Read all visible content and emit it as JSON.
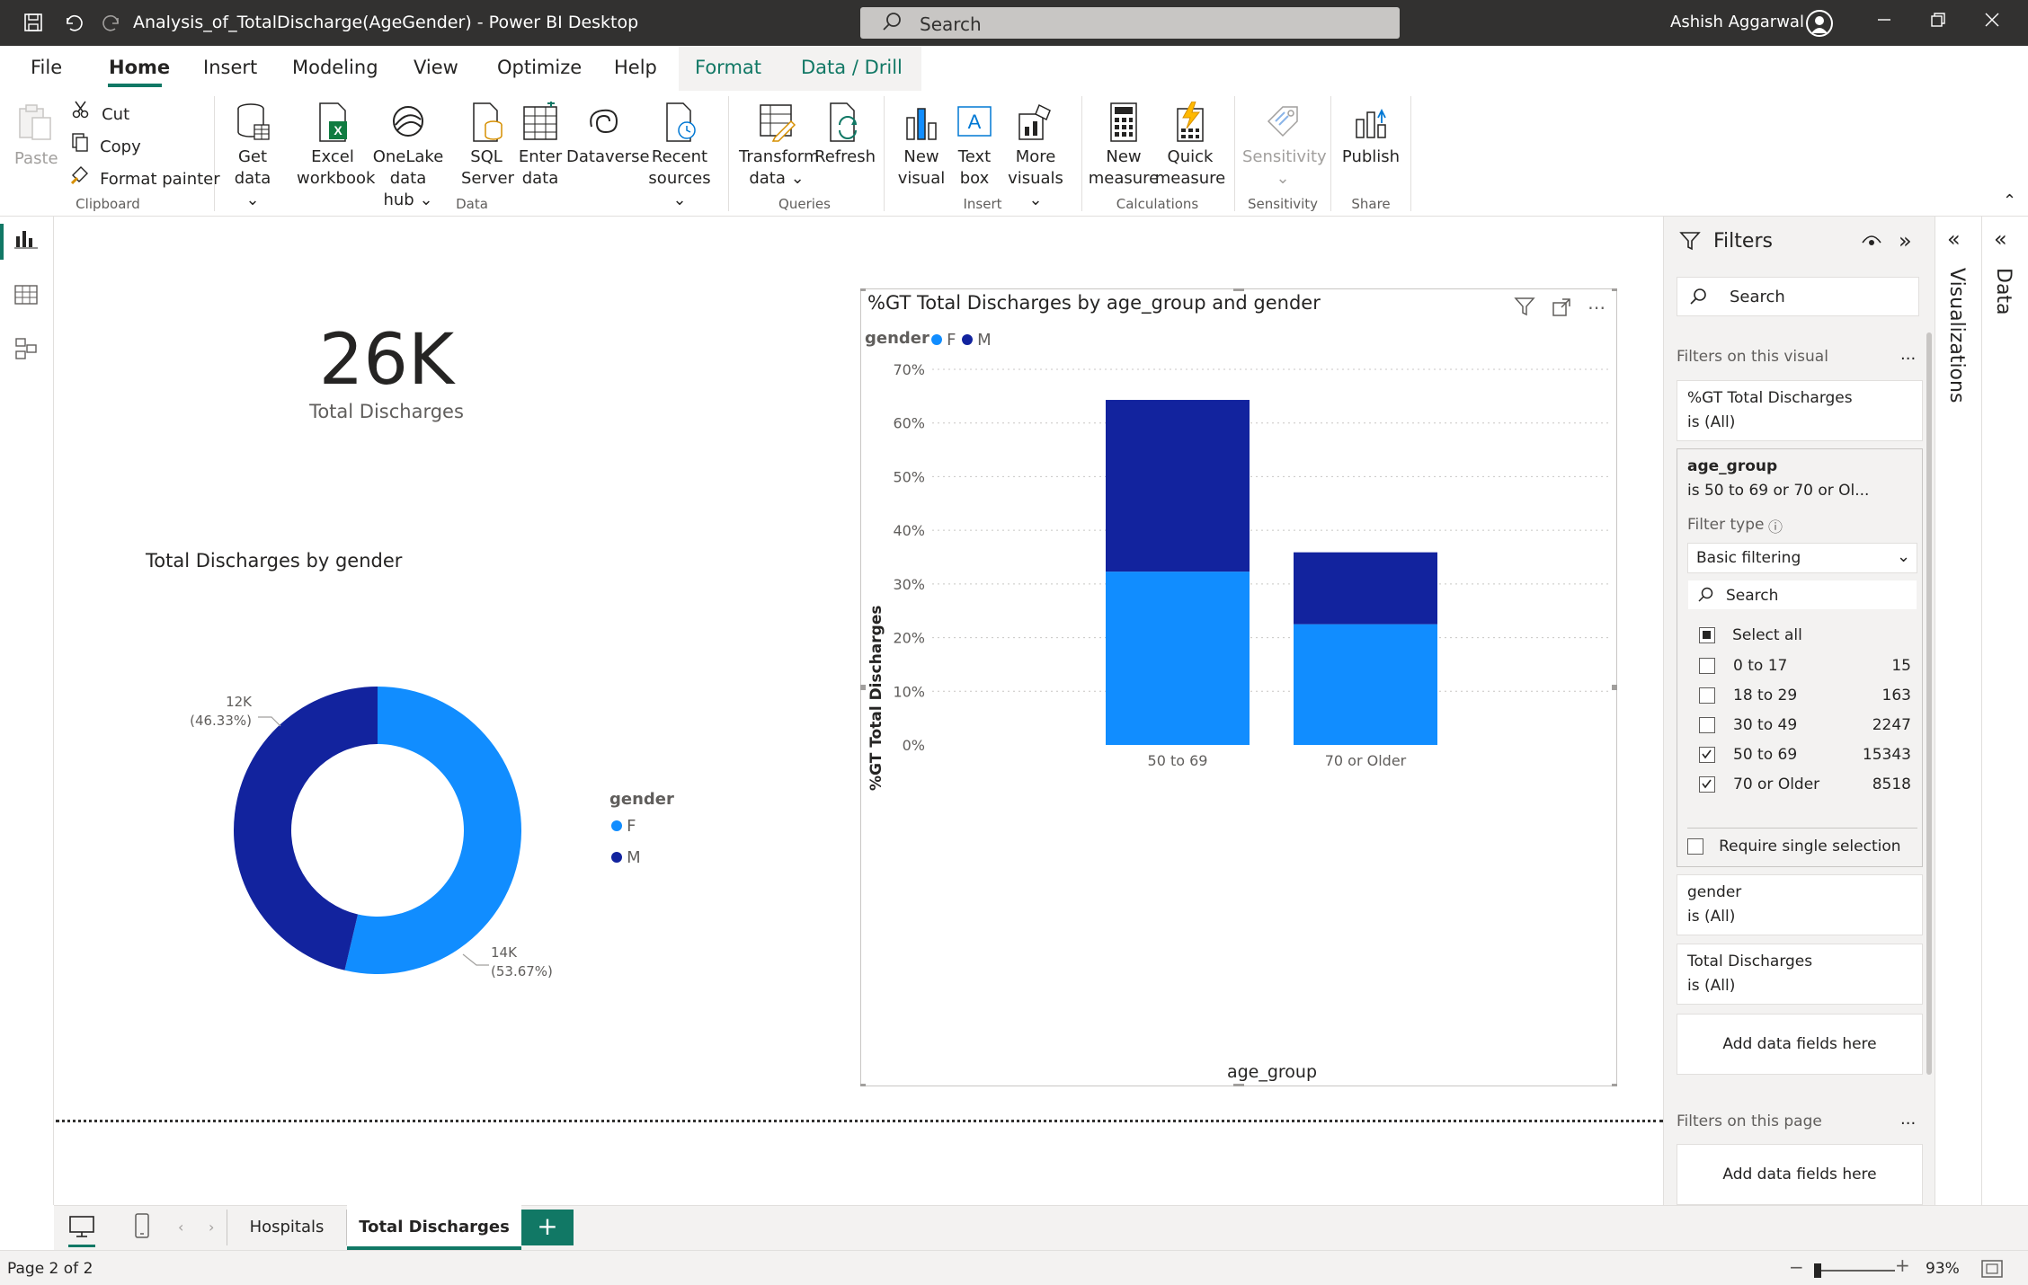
{
  "window": {
    "title": "Analysis_of_TotalDischarge(AgeGender) - Power BI Desktop",
    "search_placeholder": "Search",
    "user": "Ashish Aggarwal"
  },
  "menu": {
    "tabs": [
      "File",
      "Home",
      "Insert",
      "Modeling",
      "View",
      "Optimize",
      "Help",
      "Format",
      "Data / Drill"
    ],
    "active": "Home"
  },
  "ribbon": {
    "clipboard": {
      "paste": "Paste",
      "cut": "Cut",
      "copy": "Copy",
      "format_painter": "Format painter",
      "group": "Clipboard"
    },
    "data": {
      "get_data": [
        "Get",
        "data"
      ],
      "excel": [
        "Excel",
        "workbook"
      ],
      "onelake": [
        "OneLake data",
        "hub"
      ],
      "sql": [
        "SQL",
        "Server"
      ],
      "enter": [
        "Enter",
        "data"
      ],
      "dataverse": "Dataverse",
      "recent": [
        "Recent",
        "sources"
      ],
      "group": "Data"
    },
    "queries": {
      "transform": [
        "Transform",
        "data"
      ],
      "refresh": "Refresh",
      "group": "Queries"
    },
    "insert": {
      "new_visual": [
        "New",
        "visual"
      ],
      "text_box": [
        "Text",
        "box"
      ],
      "more_visuals": [
        "More",
        "visuals"
      ],
      "group": "Insert"
    },
    "calculations": {
      "new_measure": [
        "New",
        "measure"
      ],
      "quick_measure": [
        "Quick",
        "measure"
      ],
      "group": "Calculations"
    },
    "sensitivity": {
      "label": "Sensitivity",
      "group": "Sensitivity"
    },
    "share": {
      "publish": "Publish",
      "group": "Share"
    }
  },
  "card": {
    "value": "26K",
    "label": "Total Discharges"
  },
  "donut": {
    "title": "Total Discharges by gender",
    "legend_title": "gender",
    "labels": {
      "m": {
        "value": "12K",
        "pct": "(46.33%)"
      },
      "f": {
        "value": "14K",
        "pct": "(53.67%)"
      }
    }
  },
  "bar": {
    "title": "%GT Total Discharges by age_group and gender",
    "legend_title": "gender",
    "ylabel": "%GT Total Discharges",
    "xlabel": "age_group",
    "yticks": [
      "0%",
      "10%",
      "20%",
      "30%",
      "40%",
      "50%",
      "60%",
      "70%"
    ]
  },
  "chart_data": [
    {
      "type": "pie",
      "title": "Total Discharges by gender",
      "categories": [
        "F",
        "M"
      ],
      "values": [
        53.67,
        46.33
      ],
      "labels": [
        "14K (53.67%)",
        "12K (46.33%)"
      ],
      "legend": "right",
      "colors": {
        "F": "#118dff",
        "M": "#12239e"
      }
    },
    {
      "type": "bar",
      "stacked": true,
      "title": "%GT Total Discharges by age_group and gender",
      "categories": [
        "50 to 69",
        "70 or Older"
      ],
      "series": [
        {
          "name": "F",
          "values": [
            32.3,
            22.5
          ],
          "color": "#118dff"
        },
        {
          "name": "M",
          "values": [
            32.0,
            13.4
          ],
          "color": "#12239e"
        }
      ],
      "xlabel": "age_group",
      "ylabel": "%GT Total Discharges",
      "ylim": [
        0,
        70
      ],
      "grid": true,
      "legend": "top-left"
    }
  ],
  "filters": {
    "title": "Filters",
    "search": "Search",
    "on_visual": "Filters on this visual",
    "more": "...",
    "items": [
      {
        "name": "%GT Total Discharges",
        "value": "is (All)"
      },
      {
        "name": "age_group",
        "value": "is 50 to 69 or 70 or Ol..."
      },
      {
        "name": "gender",
        "value": "is (All)"
      },
      {
        "name": "Total Discharges",
        "value": "is (All)"
      }
    ],
    "filter_type_label": "Filter type",
    "filter_type_value": "Basic filtering",
    "list_search": "Search",
    "select_all": "Select all",
    "options": [
      {
        "label": "0 to 17",
        "count": "15"
      },
      {
        "label": "18 to 29",
        "count": "163"
      },
      {
        "label": "30 to 49",
        "count": "2247"
      },
      {
        "label": "50 to 69",
        "count": "15343"
      },
      {
        "label": "70 or Older",
        "count": "8518"
      }
    ],
    "require_single": "Require single selection",
    "add_fields": "Add data fields here",
    "on_page": "Filters on this page"
  },
  "side_tabs": {
    "visualizations": "Visualizations",
    "data": "Data"
  },
  "pages": {
    "tabs": [
      "Hospitals",
      "Total Discharges"
    ],
    "status": "Page 2 of 2",
    "zoom": "93%"
  }
}
